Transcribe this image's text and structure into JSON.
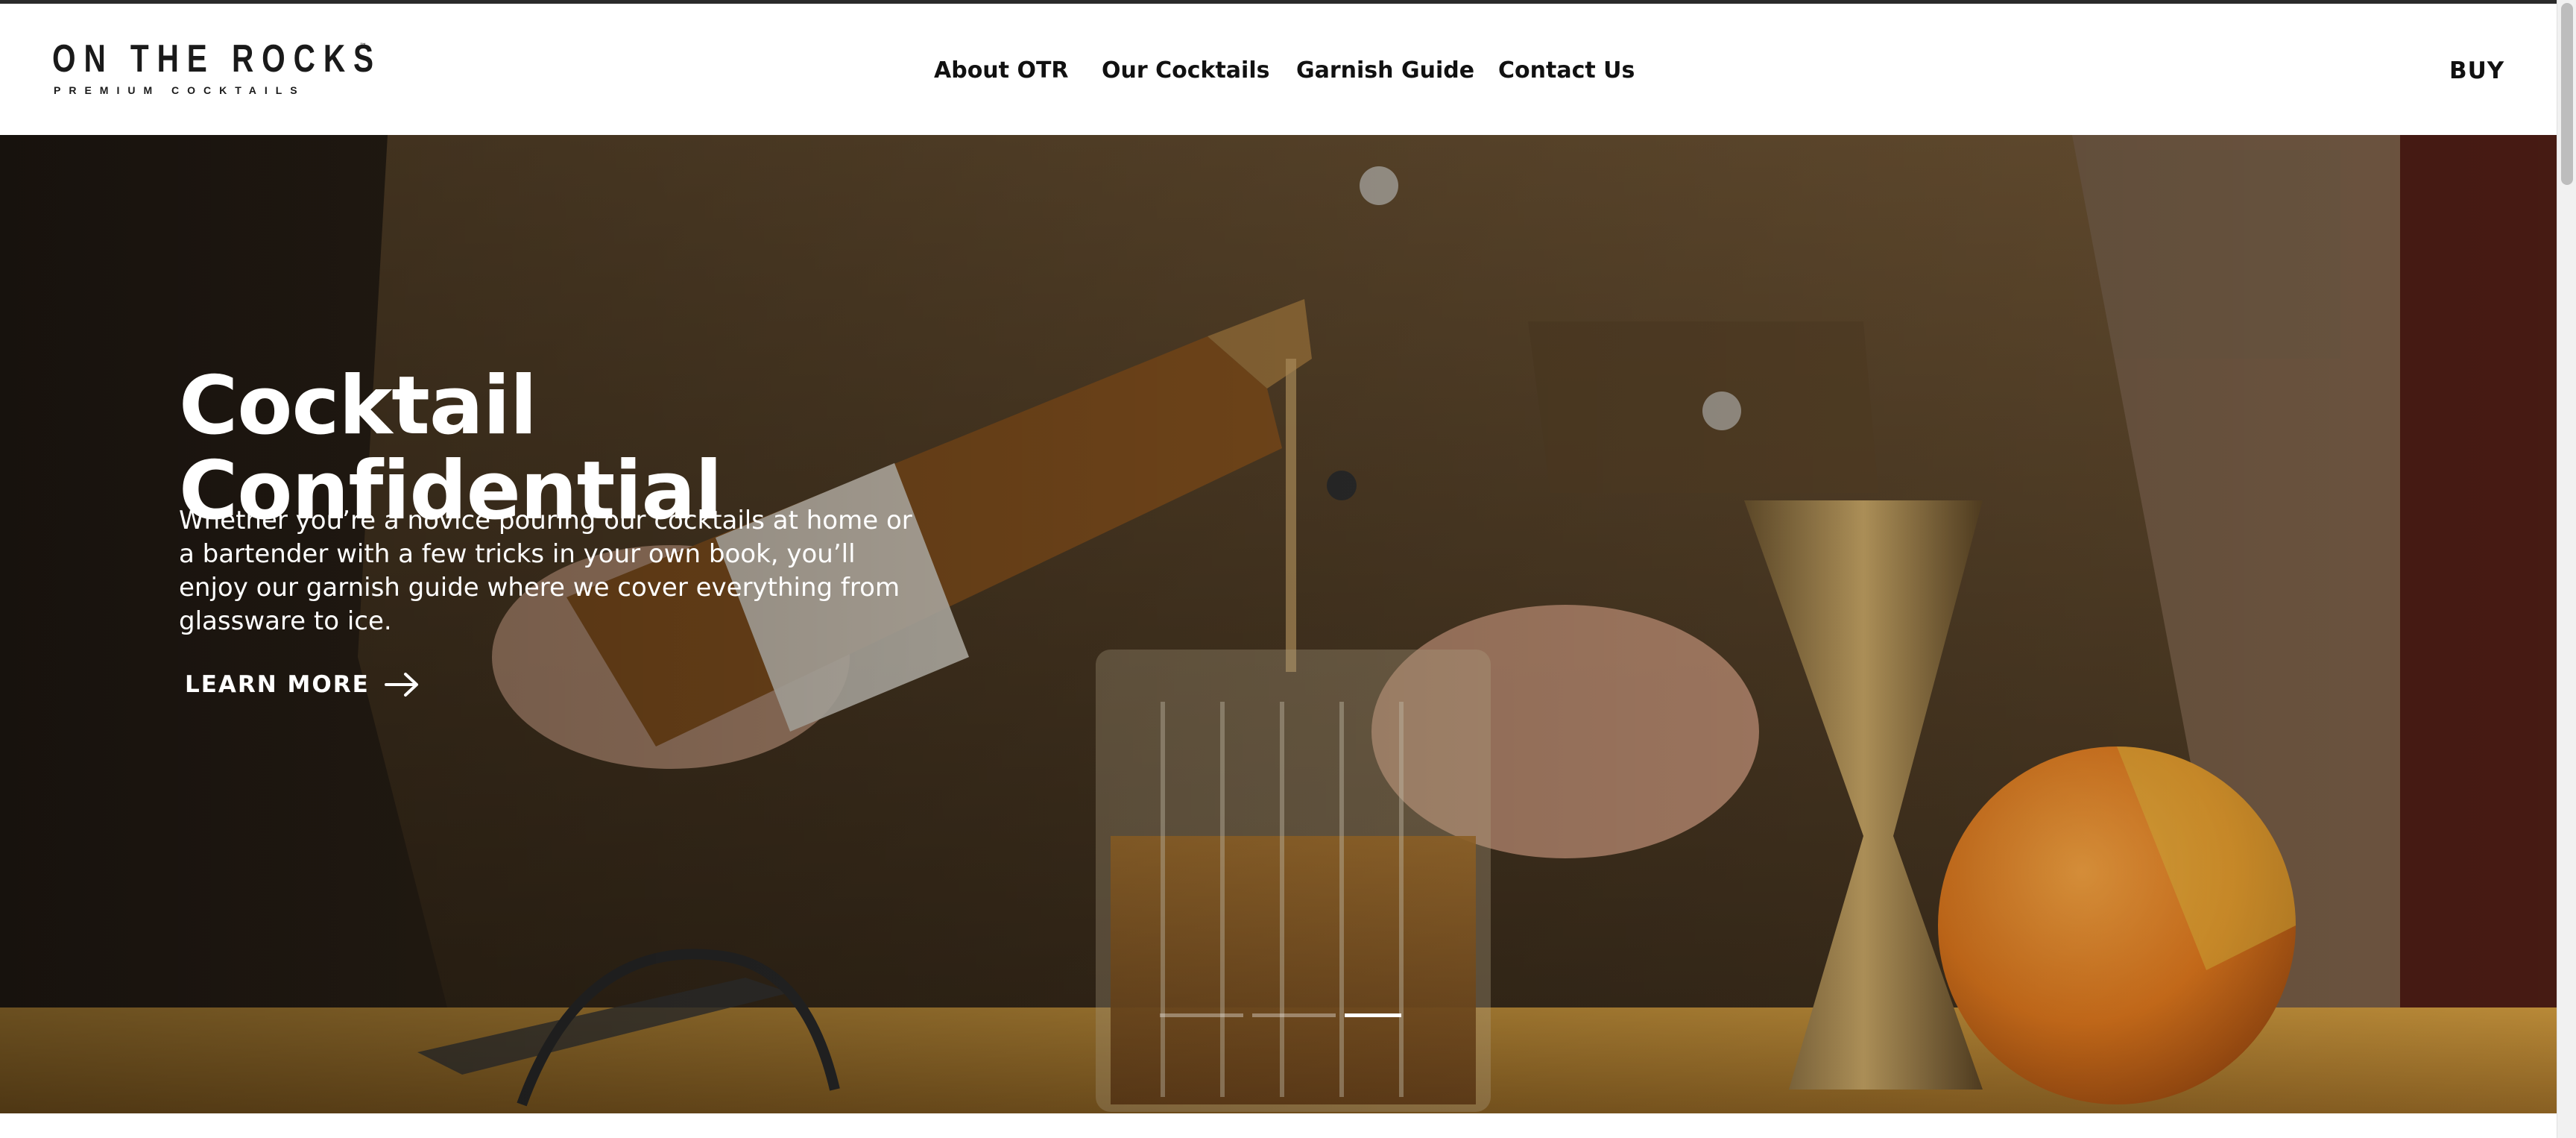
{
  "brand": {
    "name": "ON THE ROCKS",
    "tagline": "PREMIUM COCKTAILS",
    "trademark": "™"
  },
  "nav": {
    "items": [
      {
        "label": "About OTR"
      },
      {
        "label": "Our Cocktails"
      },
      {
        "label": "Garnish Guide"
      },
      {
        "label": "Contact Us"
      }
    ],
    "buy_label": "BUY"
  },
  "hero": {
    "title_line1": "Cocktail",
    "title_line2": "Confidential",
    "description": "Whether you’re a novice pouring our cocktails at home or a bartender with a few tricks in your own book, you’ll enjoy our garnish guide where we cover everything from glassware to ice.",
    "cta_label": "LEARN MORE",
    "cta_icon": "arrow-right-icon",
    "image": "bartender-pouring-old-fashioned-photo",
    "slider": {
      "slides": 3,
      "active_index": 2
    }
  },
  "colors": {
    "header_bg": "#ffffff",
    "nav_text": "#111111",
    "hero_text": "#ffffff",
    "slider_active": "#ffffff"
  }
}
